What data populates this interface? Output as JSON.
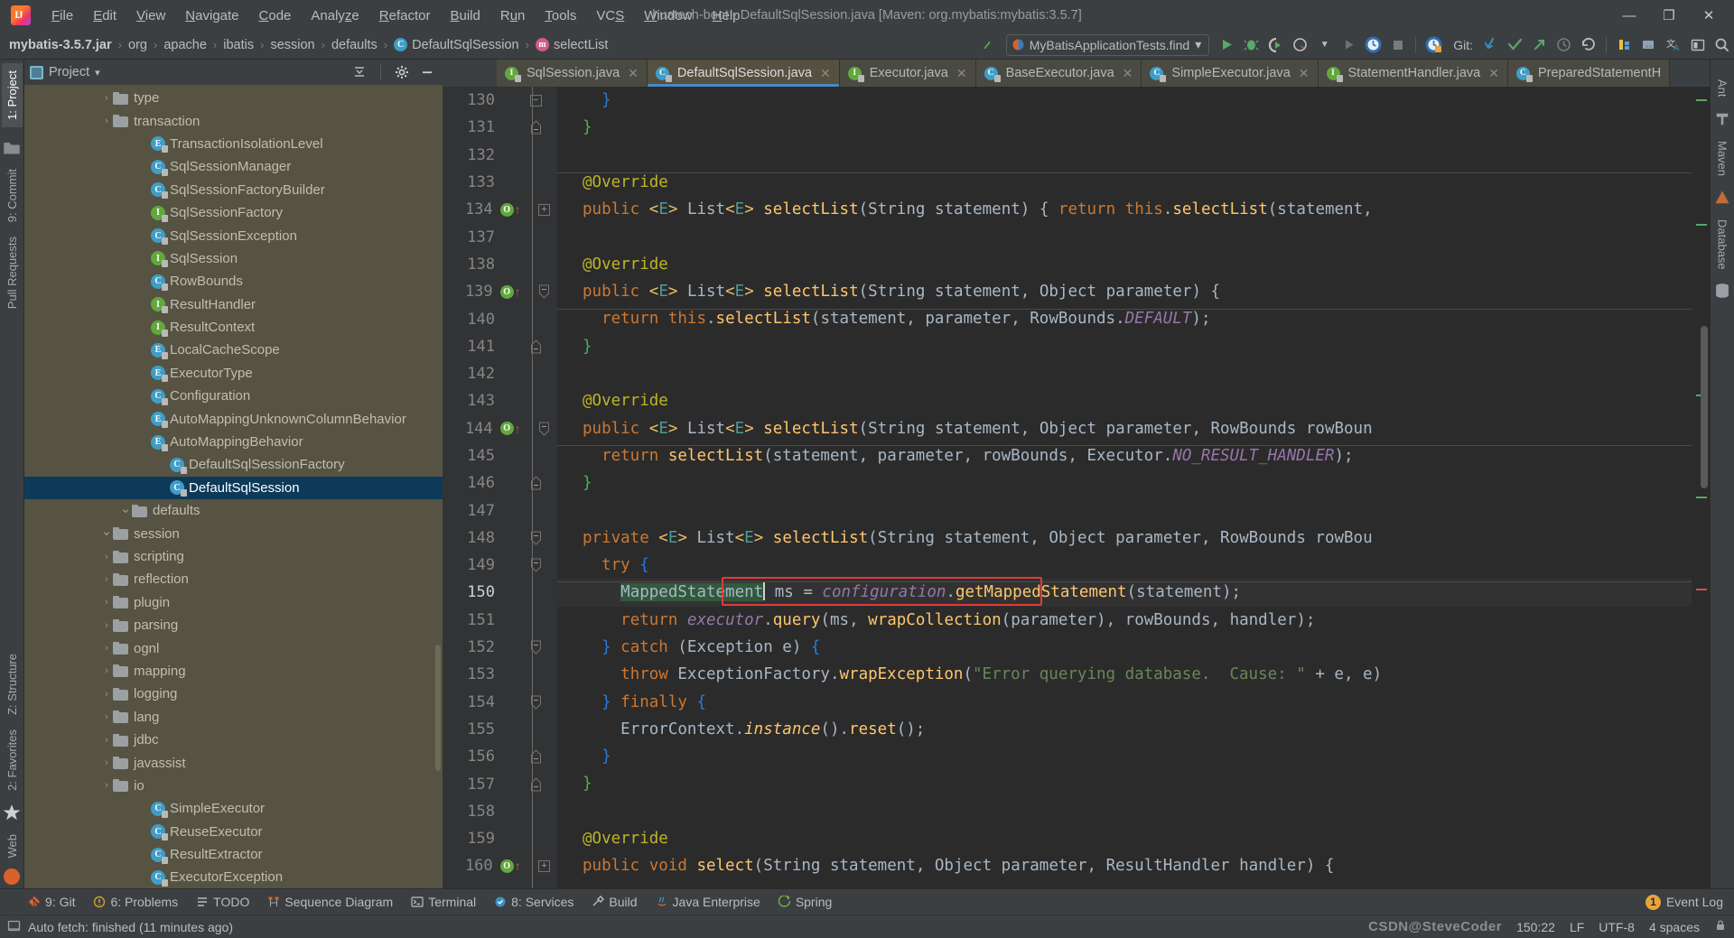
{
  "window": {
    "title": "huatech-boot - DefaultSqlSession.java [Maven: org.mybatis:mybatis:3.5.7]",
    "minimize": "—",
    "maximize": "❐",
    "close": "✕"
  },
  "menu": {
    "items": [
      "File",
      "Edit",
      "View",
      "Navigate",
      "Code",
      "Analyze",
      "Refactor",
      "Build",
      "Run",
      "Tools",
      "VCS",
      "Window",
      "Help"
    ]
  },
  "breadcrumb": {
    "items": [
      {
        "label": "mybatis-3.5.7.jar",
        "icon": "",
        "bold": true
      },
      {
        "label": "org",
        "icon": ""
      },
      {
        "label": "apache",
        "icon": ""
      },
      {
        "label": "ibatis",
        "icon": ""
      },
      {
        "label": "session",
        "icon": ""
      },
      {
        "label": "defaults",
        "icon": ""
      },
      {
        "label": "DefaultSqlSession",
        "icon": "class-icon"
      },
      {
        "label": "selectList",
        "icon": "method-icon"
      }
    ],
    "separator": "›"
  },
  "toolbar": {
    "run_config": "MyBatisApplicationTests.find",
    "dropdown_caret": "▾",
    "git_label": "Git:",
    "icons": [
      "run-icon",
      "debug-icon",
      "run-coverage-icon",
      "profile-icon",
      "rerun-icon",
      "attach-icon",
      "stop-icon",
      "updates-icon"
    ],
    "git_icons": [
      "update-project-icon",
      "commit-icon",
      "push-icon",
      "history-icon",
      "rollback-icon"
    ],
    "right_icons": [
      "hammer-icon",
      "build-module-icon",
      "translate-icon",
      "terminal-icon",
      "search-everywhere-icon"
    ]
  },
  "left_strip": {
    "tabs": [
      "1: Project",
      "9: Commit",
      "Pull Requests"
    ],
    "bottom_tabs": [
      "Z: Structure",
      "2: Favorites",
      "Web"
    ]
  },
  "right_strip": {
    "tabs": [
      "Ant",
      "Maven",
      "Database"
    ]
  },
  "project_panel": {
    "title": "Project",
    "caret": "▾",
    "collapse_tooltip": "collapse-all",
    "settings_tooltip": "settings",
    "hide_tooltip": "hide",
    "tree": [
      {
        "label": "ExecutorException",
        "type": "class",
        "indent": 6,
        "arrow": ""
      },
      {
        "label": "ResultExtractor",
        "type": "class",
        "indent": 6,
        "arrow": ""
      },
      {
        "label": "ReuseExecutor",
        "type": "class",
        "indent": 6,
        "arrow": ""
      },
      {
        "label": "SimpleExecutor",
        "type": "class",
        "indent": 6,
        "arrow": ""
      },
      {
        "label": "io",
        "type": "folder",
        "indent": 4,
        "arrow": "›"
      },
      {
        "label": "javassist",
        "type": "folder",
        "indent": 4,
        "arrow": "›"
      },
      {
        "label": "jdbc",
        "type": "folder",
        "indent": 4,
        "arrow": "›"
      },
      {
        "label": "lang",
        "type": "folder",
        "indent": 4,
        "arrow": "›"
      },
      {
        "label": "logging",
        "type": "folder",
        "indent": 4,
        "arrow": "›"
      },
      {
        "label": "mapping",
        "type": "folder",
        "indent": 4,
        "arrow": "›"
      },
      {
        "label": "ognl",
        "type": "folder",
        "indent": 4,
        "arrow": "›"
      },
      {
        "label": "parsing",
        "type": "folder",
        "indent": 4,
        "arrow": "›"
      },
      {
        "label": "plugin",
        "type": "folder",
        "indent": 4,
        "arrow": "›"
      },
      {
        "label": "reflection",
        "type": "folder",
        "indent": 4,
        "arrow": "›"
      },
      {
        "label": "scripting",
        "type": "folder",
        "indent": 4,
        "arrow": "›"
      },
      {
        "label": "session",
        "type": "folder",
        "indent": 4,
        "arrow": "∨"
      },
      {
        "label": "defaults",
        "type": "folder",
        "indent": 5,
        "arrow": "∨"
      },
      {
        "label": "DefaultSqlSession",
        "type": "class",
        "indent": 7,
        "arrow": "",
        "selected": true
      },
      {
        "label": "DefaultSqlSessionFactory",
        "type": "class",
        "indent": 7,
        "arrow": ""
      },
      {
        "label": "AutoMappingBehavior",
        "type": "enum",
        "indent": 6,
        "arrow": ""
      },
      {
        "label": "AutoMappingUnknownColumnBehavior",
        "type": "enum",
        "indent": 6,
        "arrow": ""
      },
      {
        "label": "Configuration",
        "type": "class",
        "indent": 6,
        "arrow": ""
      },
      {
        "label": "ExecutorType",
        "type": "enum",
        "indent": 6,
        "arrow": ""
      },
      {
        "label": "LocalCacheScope",
        "type": "enum",
        "indent": 6,
        "arrow": ""
      },
      {
        "label": "ResultContext",
        "type": "interface",
        "indent": 6,
        "arrow": ""
      },
      {
        "label": "ResultHandler",
        "type": "interface",
        "indent": 6,
        "arrow": ""
      },
      {
        "label": "RowBounds",
        "type": "class",
        "indent": 6,
        "arrow": ""
      },
      {
        "label": "SqlSession",
        "type": "interface",
        "indent": 6,
        "arrow": ""
      },
      {
        "label": "SqlSessionException",
        "type": "class",
        "indent": 6,
        "arrow": ""
      },
      {
        "label": "SqlSessionFactory",
        "type": "interface",
        "indent": 6,
        "arrow": ""
      },
      {
        "label": "SqlSessionFactoryBuilder",
        "type": "class",
        "indent": 6,
        "arrow": ""
      },
      {
        "label": "SqlSessionManager",
        "type": "class",
        "indent": 6,
        "arrow": ""
      },
      {
        "label": "TransactionIsolationLevel",
        "type": "enum",
        "indent": 6,
        "arrow": ""
      },
      {
        "label": "transaction",
        "type": "folder",
        "indent": 4,
        "arrow": "›"
      },
      {
        "label": "type",
        "type": "folder",
        "indent": 4,
        "arrow": "›"
      }
    ]
  },
  "editor": {
    "tabs": [
      {
        "label": "SqlSession.java",
        "type": "interface",
        "active": false
      },
      {
        "label": "DefaultSqlSession.java",
        "type": "class",
        "active": true
      },
      {
        "label": "Executor.java",
        "type": "interface",
        "active": false
      },
      {
        "label": "BaseExecutor.java",
        "type": "class-abstract",
        "active": false
      },
      {
        "label": "SimpleExecutor.java",
        "type": "class",
        "active": false
      },
      {
        "label": "StatementHandler.java",
        "type": "interface",
        "active": false
      },
      {
        "label": "PreparedStatementH",
        "type": "class",
        "active": false
      }
    ],
    "close_glyph": "✕",
    "lines": [
      {
        "num": "130",
        "fold": "minus",
        "mark": ""
      },
      {
        "num": "131",
        "fold": "end",
        "mark": ""
      },
      {
        "num": "132",
        "fold": "",
        "mark": ""
      },
      {
        "num": "133",
        "fold": "",
        "mark": ""
      },
      {
        "num": "134",
        "fold": "plus",
        "mark": "override"
      },
      {
        "num": "137",
        "fold": "",
        "mark": ""
      },
      {
        "num": "138",
        "fold": "",
        "mark": ""
      },
      {
        "num": "139",
        "fold": "start",
        "mark": "override"
      },
      {
        "num": "140",
        "fold": "",
        "mark": ""
      },
      {
        "num": "141",
        "fold": "end",
        "mark": ""
      },
      {
        "num": "142",
        "fold": "",
        "mark": ""
      },
      {
        "num": "143",
        "fold": "",
        "mark": ""
      },
      {
        "num": "144",
        "fold": "start",
        "mark": "override"
      },
      {
        "num": "145",
        "fold": "",
        "mark": ""
      },
      {
        "num": "146",
        "fold": "end",
        "mark": ""
      },
      {
        "num": "147",
        "fold": "",
        "mark": ""
      },
      {
        "num": "148",
        "fold": "start",
        "mark": ""
      },
      {
        "num": "149",
        "fold": "start",
        "mark": ""
      },
      {
        "num": "150",
        "fold": "",
        "mark": "",
        "current": true
      },
      {
        "num": "151",
        "fold": "",
        "mark": ""
      },
      {
        "num": "152",
        "fold": "start",
        "mark": ""
      },
      {
        "num": "153",
        "fold": "",
        "mark": ""
      },
      {
        "num": "154",
        "fold": "start",
        "mark": ""
      },
      {
        "num": "155",
        "fold": "",
        "mark": ""
      },
      {
        "num": "156",
        "fold": "end",
        "mark": ""
      },
      {
        "num": "157",
        "fold": "end",
        "mark": ""
      },
      {
        "num": "158",
        "fold": "",
        "mark": ""
      },
      {
        "num": "159",
        "fold": "",
        "mark": ""
      },
      {
        "num": "160",
        "fold": "plus",
        "mark": "override"
      }
    ],
    "code_text": [
      "  }",
      "}",
      "",
      "@Override",
      "public <E> List<E> selectList(String statement) { return this.selectList(statement,",
      "",
      "@Override",
      "public <E> List<E> selectList(String statement, Object parameter) {",
      "  return this.selectList(statement, parameter, RowBounds.DEFAULT);",
      "}",
      "",
      "@Override",
      "public <E> List<E> selectList(String statement, Object parameter, RowBounds rowBoun",
      "  return selectList(statement, parameter, rowBounds, Executor.NO_RESULT_HANDLER);",
      "}",
      "",
      "private <E> List<E> selectList(String statement, Object parameter, RowBounds rowBou",
      "  try {",
      "    MappedStatement ms = configuration.getMappedStatement(statement);",
      "    return executor.query(ms, wrapCollection(parameter), rowBounds, handler);",
      "  } catch (Exception e) {",
      "    throw ExceptionFactory.wrapException(\"Error querying database.  Cause: \" + e, e)",
      "  } finally {",
      "    ErrorContext.instance().reset();",
      "  }",
      "}",
      "",
      "@Override",
      "public void select(String statement, Object parameter, ResultHandler handler) {"
    ]
  },
  "bottom_bar": {
    "items": [
      {
        "label": "9: Git",
        "icon": "git-icon"
      },
      {
        "label": "6: Problems",
        "icon": "problems-icon"
      },
      {
        "label": "TODO",
        "icon": "todo-icon"
      },
      {
        "label": "Sequence Diagram",
        "icon": "sequence-diagram-icon"
      },
      {
        "label": "Terminal",
        "icon": "terminal-icon"
      },
      {
        "label": "8: Services",
        "icon": "services-icon"
      },
      {
        "label": "Build",
        "icon": "build-icon"
      },
      {
        "label": "Java Enterprise",
        "icon": "java-enterprise-icon"
      },
      {
        "label": "Spring",
        "icon": "spring-icon"
      }
    ],
    "event_log": {
      "label": "Event Log",
      "count": "1"
    }
  },
  "status_bar": {
    "message": "Auto fetch: finished (11 minutes ago)",
    "caret_position": "150:22",
    "line_separator": "LF",
    "encoding": "UTF-8",
    "indent": "4 spaces",
    "watermark": "CSDN@SteveCoder"
  }
}
